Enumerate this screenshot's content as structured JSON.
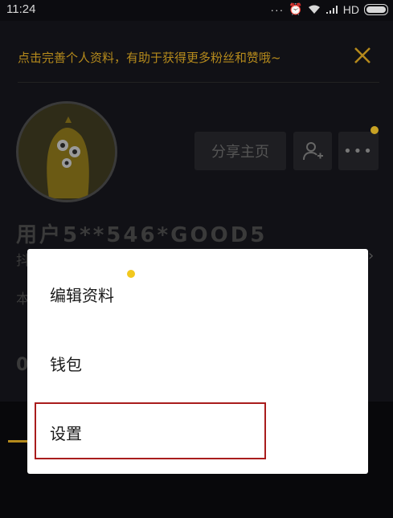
{
  "status_bar": {
    "time": "11:24",
    "network": "HD"
  },
  "banner": {
    "text": "点击完善个人资料，有助于获得更多粉丝和赞哦~",
    "close_icon": "close-icon"
  },
  "profile": {
    "share_label": "分享主页",
    "username_masked": "用户5**546*GOOD5",
    "add_friend_icon": "add-friend-icon",
    "more_icon": "more-icon",
    "fragment_1": "抖",
    "fragment_2": "本",
    "fragment_3": "0"
  },
  "menu": {
    "items": [
      {
        "label": "编辑资料"
      },
      {
        "label": "钱包"
      },
      {
        "label": "设置"
      }
    ]
  },
  "colors": {
    "accent": "#b58a1c",
    "highlight_box": "#a91c1c",
    "notify_dot": "#f2c81e"
  }
}
